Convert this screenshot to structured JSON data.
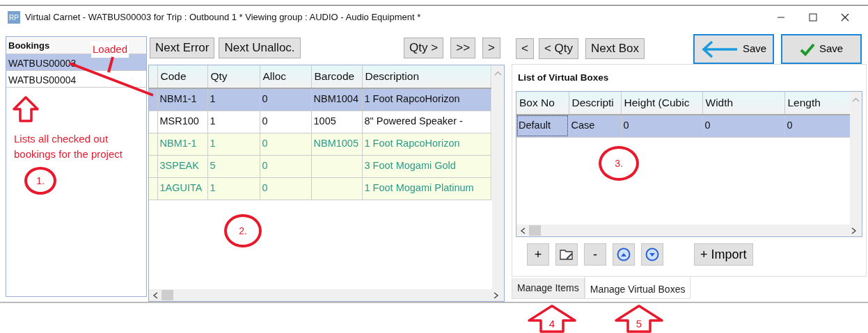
{
  "window": {
    "title": "Virtual Carnet - WATBUS00003 for Trip : Outbound 1 * Viewing group : AUDIO - Audio Equipment *",
    "app_badge": "RP"
  },
  "bookings": {
    "header": "Bookings",
    "items": [
      {
        "label": "WATBUS00003",
        "selected": true
      },
      {
        "label": "WATBUS00004",
        "selected": false
      }
    ]
  },
  "items_toolbar": {
    "left": [
      "Next Error",
      "Next Unalloc."
    ],
    "right": [
      "Qty >",
      ">>",
      ">"
    ]
  },
  "items_grid": {
    "columns": [
      "Code",
      "Qty",
      "Alloc",
      "Barcode",
      "Description"
    ],
    "rows": [
      {
        "cells": [
          "NBM1-1",
          "1",
          "0",
          "NBM1004",
          "1 Foot RapcoHorizon"
        ],
        "selected": true,
        "kind": "plain"
      },
      {
        "cells": [
          "MSR100",
          "1",
          "0",
          "1005",
          "8\" Powered Speaker -"
        ],
        "selected": false,
        "kind": "plain"
      },
      {
        "cells": [
          "NBM1-1",
          "1",
          "0",
          "NBM1005",
          "1 Foot RapcoHorizon"
        ],
        "selected": false,
        "kind": "highlighted"
      },
      {
        "cells": [
          "3SPEAK",
          "5",
          "0",
          "",
          "3 Foot Mogami Gold"
        ],
        "selected": false,
        "kind": "highlighted"
      },
      {
        "cells": [
          "1AGUITA",
          "1",
          "0",
          "",
          "1 Foot Mogami Platinum"
        ],
        "selected": false,
        "kind": "highlighted"
      }
    ]
  },
  "box_toolbar": [
    "<",
    "< Qty",
    "Next Box"
  ],
  "save_buttons": [
    {
      "label": "Save",
      "kind": "back"
    },
    {
      "label": "Save",
      "kind": "confirm"
    }
  ],
  "virtual_boxes": {
    "title": "List of Virtual Boxes",
    "columns": [
      "Box No",
      "Descripti",
      "Height (Cubic",
      "Width",
      "Length"
    ],
    "rows": [
      {
        "cells": [
          "Default",
          "Case",
          "0",
          "0",
          "0"
        ],
        "selected": true
      }
    ],
    "buttons": [
      {
        "kind": "text",
        "label": "+"
      },
      {
        "kind": "edit"
      },
      {
        "kind": "text",
        "label": "-"
      },
      {
        "kind": "up"
      },
      {
        "kind": "down"
      },
      {
        "kind": "gap"
      },
      {
        "kind": "text",
        "label": "+ Import"
      }
    ]
  },
  "tabs": [
    {
      "label": "Manage Items",
      "selected": false
    },
    {
      "label": "Manage Virtual Boxes",
      "selected": true
    }
  ],
  "annotations": {
    "loaded_label": "Loaded",
    "note": "Lists all checked out bookings for the project",
    "markers": [
      {
        "kind": "circle",
        "label": "1."
      },
      {
        "kind": "circle",
        "label": "2."
      },
      {
        "kind": "circle",
        "label": "3."
      },
      {
        "kind": "arrow",
        "label": "4"
      },
      {
        "kind": "arrow",
        "label": "5"
      }
    ]
  }
}
